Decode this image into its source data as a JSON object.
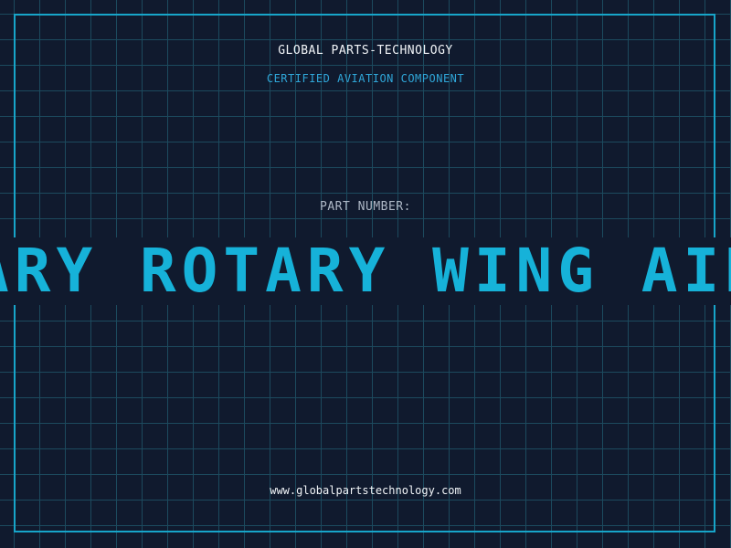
{
  "header": {
    "company": "GLOBAL PARTS-TECHNOLOGY",
    "subtitle": "CERTIFIED AVIATION COMPONENT"
  },
  "part": {
    "label": "PART NUMBER:",
    "marquee_text": "ARY ROTARY WING AIR"
  },
  "footer": {
    "website": "www.globalpartstechnology.com"
  },
  "colors": {
    "background": "#101a2e",
    "grid": "#1c4a5e",
    "accent": "#17a5c9",
    "text": "#f2f5f8"
  }
}
